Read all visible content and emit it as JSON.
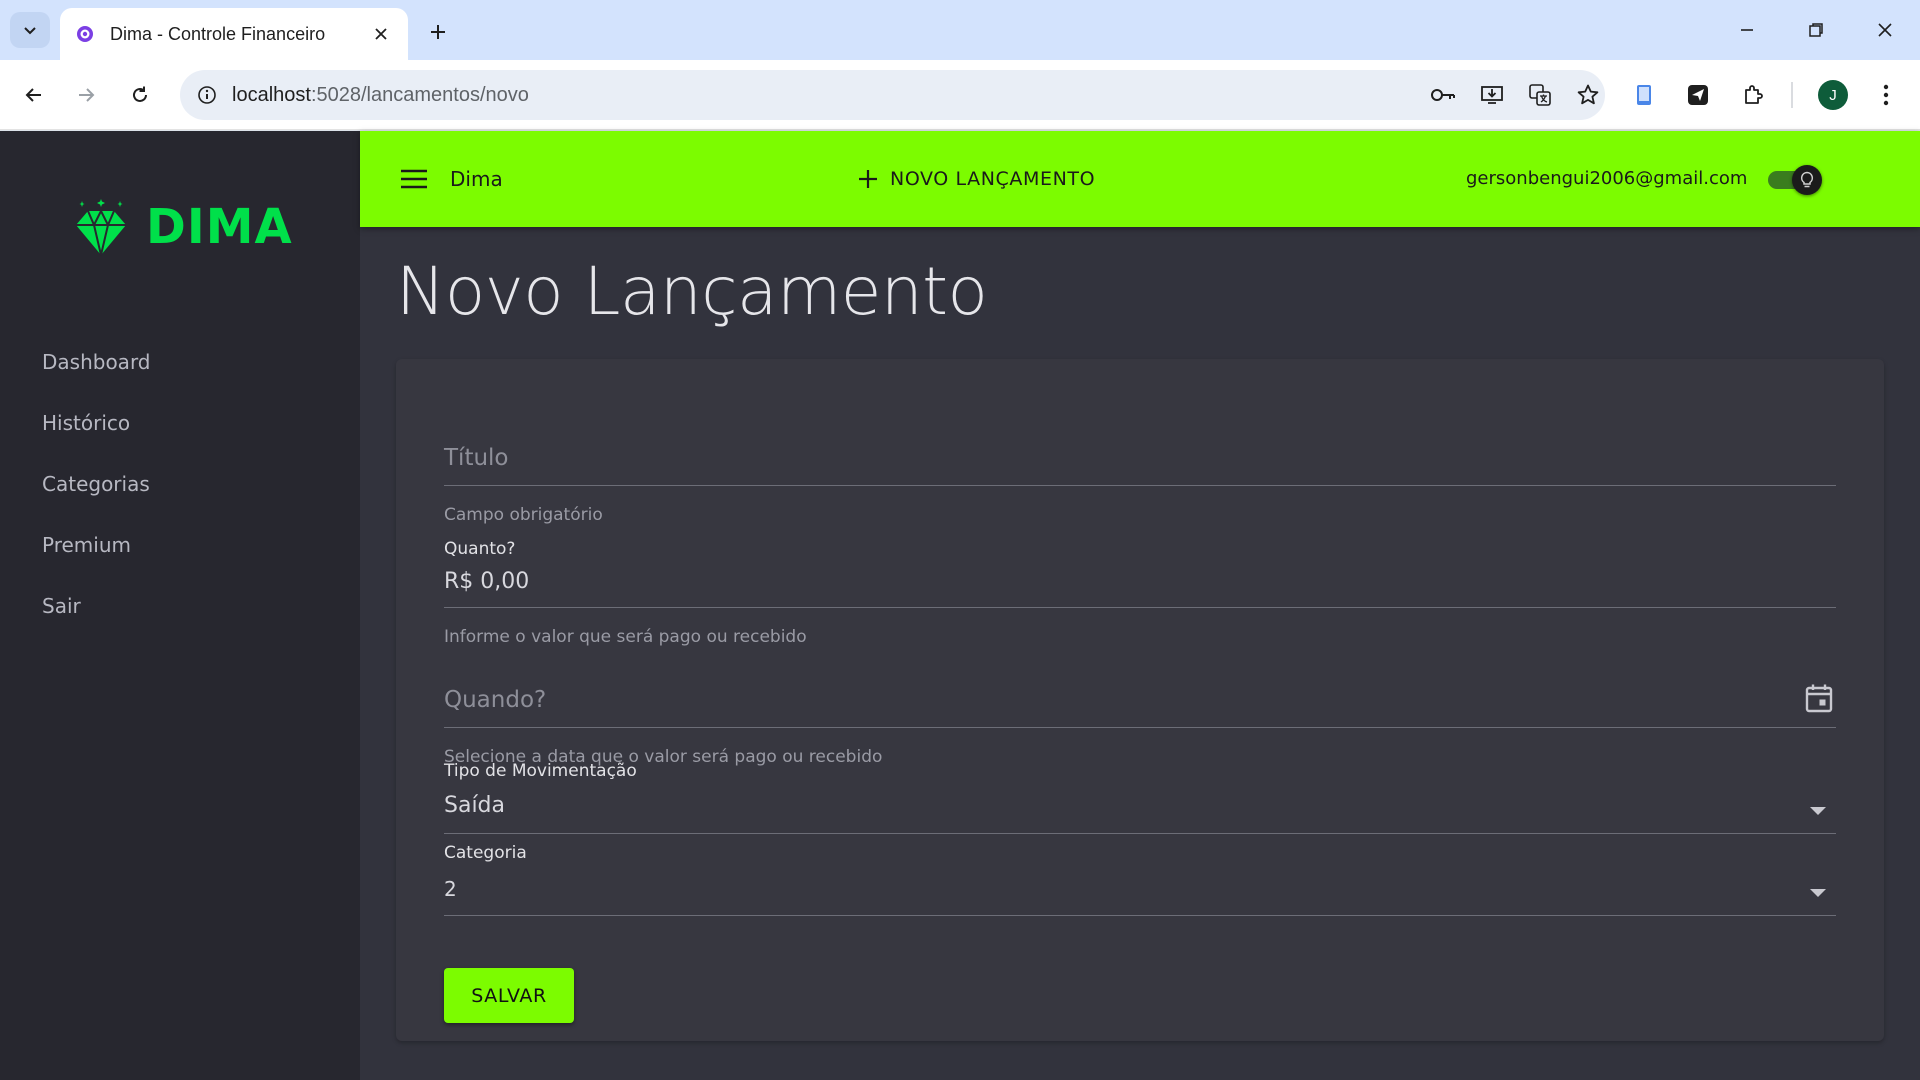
{
  "browser": {
    "tab_title": "Dima - Controle Financeiro",
    "url_host": "localhost",
    "url_path": ":5028/lancamentos/novo",
    "profile_initial": "J"
  },
  "sidebar": {
    "brand": "DIMA",
    "items": [
      {
        "label": "Dashboard"
      },
      {
        "label": "Histórico"
      },
      {
        "label": "Categorias"
      },
      {
        "label": "Premium"
      },
      {
        "label": "Sair"
      }
    ]
  },
  "appbar": {
    "title": "Dima",
    "new_button_label": "NOVO LANÇAMENTO",
    "user_email": "gersonbengui2006@gmail.com",
    "theme_toggle_on": true
  },
  "page": {
    "title": "Novo Lançamento"
  },
  "form": {
    "titulo": {
      "placeholder": "Título",
      "helper": "Campo obrigatório"
    },
    "valor": {
      "label": "Quanto?",
      "value": "R$ 0,00",
      "helper": "Informe o valor que será pago ou recebido"
    },
    "data": {
      "placeholder": "Quando?",
      "helper": "Selecione a data que o valor será pago ou recebido"
    },
    "tipo": {
      "label": "Tipo de Movimentação",
      "value": "Saída"
    },
    "categoria": {
      "label": "Categoria",
      "value": "2"
    },
    "save_label": "SALVAR"
  },
  "colors": {
    "accent": "#7cfc00",
    "brand": "#00e04a",
    "sidebar_bg": "#27272f",
    "content_bg": "#32333d",
    "card_bg": "#373740"
  }
}
